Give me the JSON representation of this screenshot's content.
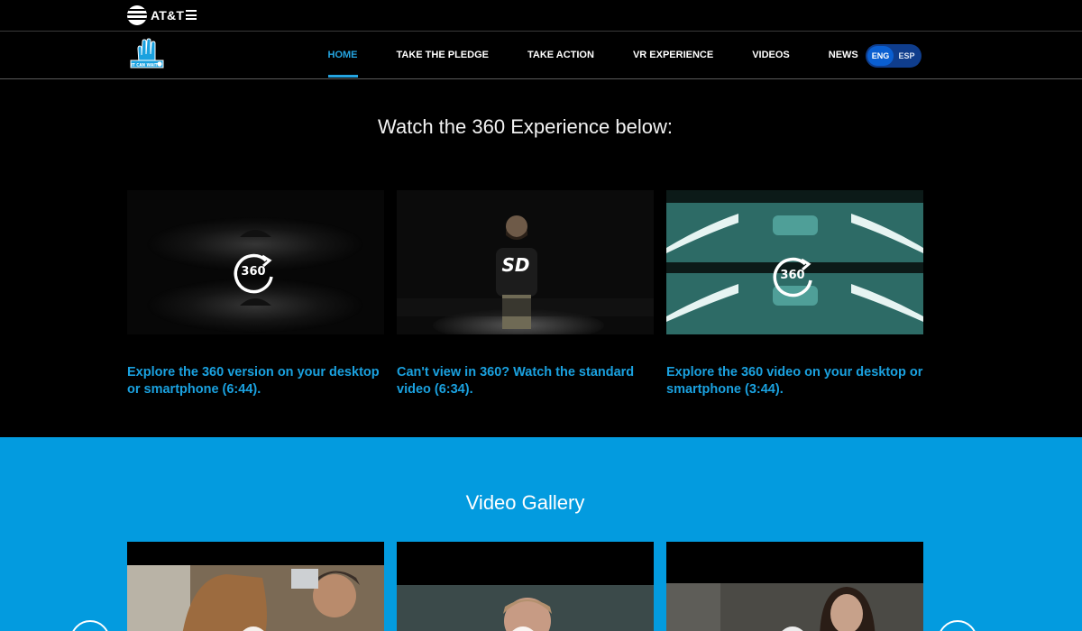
{
  "topbar": {
    "brand_name": "AT&T",
    "menu_icon": "hamburger-menu-icon"
  },
  "nav": {
    "logo_text": "IT CAN WAIT",
    "links": [
      {
        "label": "HOME",
        "active": true
      },
      {
        "label": "TAKE THE PLEDGE",
        "active": false
      },
      {
        "label": "TAKE ACTION",
        "active": false
      },
      {
        "label": "VR EXPERIENCE",
        "active": false
      },
      {
        "label": "VIDEOS",
        "active": false
      },
      {
        "label": "NEWS",
        "active": false
      }
    ],
    "languages": [
      {
        "label": "ENG",
        "selected": true
      },
      {
        "label": "ESP",
        "selected": false
      }
    ]
  },
  "experience": {
    "title": "Watch the 360 Experience below:",
    "cards": [
      {
        "badge": "360",
        "link": "Explore the 360 version on your desktop or smartphone (6:44)."
      },
      {
        "badge": "SD",
        "link": "Can't view in 360? Watch the standard video (6:34)."
      },
      {
        "badge": "360",
        "link": "Explore the 360 video on your desktop or smartphone (3:44)."
      }
    ]
  },
  "gallery": {
    "title": "Video Gallery",
    "prev_icon": "chevron-left-icon",
    "next_icon": "chevron-right-icon"
  },
  "colors": {
    "accent": "#1aa1df",
    "gallery_bg": "#039bdf",
    "lang_bg": "#0f3d8c"
  }
}
